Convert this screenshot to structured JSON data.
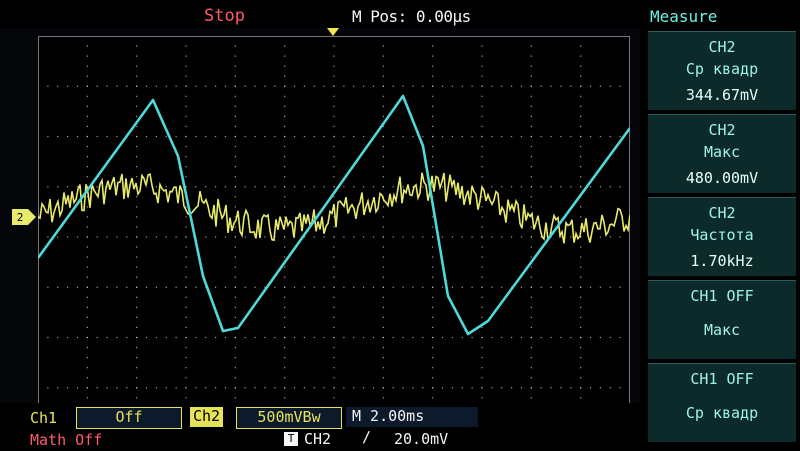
{
  "header": {
    "status": "Stop",
    "mpos": "M Pos: 0.00µs"
  },
  "ch2_marker": "2",
  "measure": {
    "title": "Measure",
    "boxes": [
      {
        "l1": "CH2",
        "l2": "Ср квадр",
        "l3": "344.67mV"
      },
      {
        "l1": "CH2",
        "l2": "Макс",
        "l3": "480.00mV"
      },
      {
        "l1": "CH2",
        "l2": "Частота",
        "l3": "1.70kHz"
      },
      {
        "l1": "CH1 OFF",
        "l2": "Макс",
        "l3": ""
      },
      {
        "l1": "CH1 OFF",
        "l2": "Ср квадр",
        "l3": ""
      }
    ]
  },
  "bottom": {
    "ch1_label": "Ch1",
    "ch1_value": "Off",
    "ch2_label": "Ch2",
    "ch2_value": "500mVBw",
    "timebase": "M 2.00ms",
    "math": "Math Off",
    "trigger_icon": "T",
    "trigger_source": "CH2",
    "trigger_edge": "∕",
    "trigger_level": "20.0mV"
  },
  "colors": {
    "cyan_trace": "#4fd8d8",
    "yellow_trace": "#e7ea6a",
    "grid": "#d8d8d8",
    "measure_text": "#9ff3e6"
  }
}
